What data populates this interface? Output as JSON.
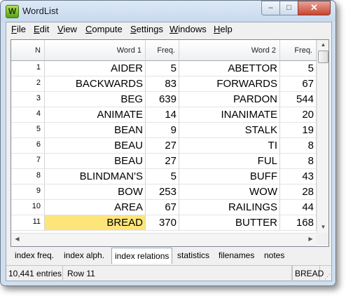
{
  "window": {
    "title": "WordList",
    "icon_letter": "W"
  },
  "controls": {
    "minimize": "▭",
    "maximize": "□",
    "close": "✕"
  },
  "menu": [
    {
      "label": "File",
      "u": "F",
      "rest": "ile"
    },
    {
      "label": "Edit",
      "u": "E",
      "rest": "dit"
    },
    {
      "label": "View",
      "u": "V",
      "rest": "iew"
    },
    {
      "label": "Compute",
      "u": "C",
      "rest": "ompute"
    },
    {
      "label": "Settings",
      "u": "S",
      "rest": "ettings"
    },
    {
      "label": "Windows",
      "u": "W",
      "rest": "indows"
    },
    {
      "label": "Help",
      "u": "H",
      "rest": "elp"
    }
  ],
  "table": {
    "headers": [
      "N",
      "Word 1",
      "Freq.",
      "Word 2",
      "Freq."
    ],
    "rows": [
      [
        "1",
        "AIDER",
        "5",
        "ABETTOR",
        "5"
      ],
      [
        "2",
        "BACKWARDS",
        "83",
        "FORWARDS",
        "67"
      ],
      [
        "3",
        "BEG",
        "639",
        "PARDON",
        "544"
      ],
      [
        "4",
        "ANIMATE",
        "14",
        "INANIMATE",
        "20"
      ],
      [
        "5",
        "BEAN",
        "9",
        "STALK",
        "19"
      ],
      [
        "6",
        "BEAU",
        "27",
        "TI",
        "8"
      ],
      [
        "7",
        "BEAU",
        "27",
        "FUL",
        "8"
      ],
      [
        "8",
        "BLINDMAN'S",
        "5",
        "BUFF",
        "43"
      ],
      [
        "9",
        "BOW",
        "253",
        "WOW",
        "28"
      ],
      [
        "10",
        "AREA",
        "67",
        "RAILINGS",
        "44"
      ],
      [
        "11",
        "BREAD",
        "370",
        "BUTTER",
        "168"
      ]
    ],
    "selected_row": 10,
    "selected_color": "#fde57a"
  },
  "tabs": [
    "index freq.",
    "index alph.",
    "index relations",
    "statistics",
    "filenames",
    "notes"
  ],
  "active_tab": 2,
  "status": {
    "entries": "10,441 entries",
    "row": "Row 11",
    "word": "BREAD"
  }
}
